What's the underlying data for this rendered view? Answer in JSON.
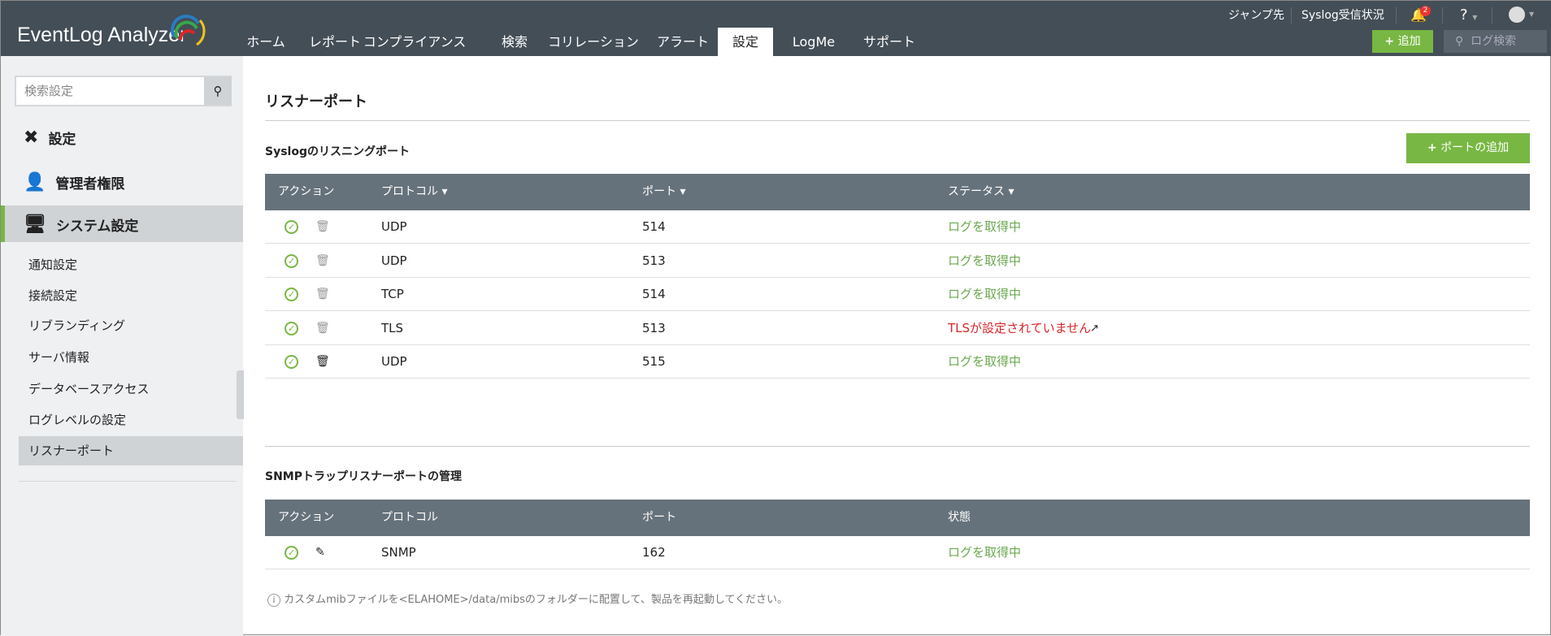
{
  "header": {
    "logo": "EventLog Analyzer",
    "tabs": [
      "ホーム",
      "レポート",
      "コンプライアンス",
      "検索",
      "コリレーション",
      "アラート",
      "設定",
      "LogMe",
      "サポート"
    ],
    "active_tab": "設定",
    "jump": "ジャンプ先",
    "syslog_status": "Syslog受信状況",
    "notification_count": "2",
    "help": "?",
    "add_label": "追加",
    "log_search_placeholder": "ログ検索"
  },
  "sidebar": {
    "search_placeholder": "検索設定",
    "menu": [
      "設定",
      "管理者権限",
      "システム設定"
    ],
    "sub_items": [
      "通知設定",
      "接続設定",
      "リブランディング",
      "サーバ情報",
      "データベースアクセス",
      "ログレベルの設定",
      "リスナーポート"
    ],
    "active_sub": "リスナーポート"
  },
  "main": {
    "title": "リスナーポート",
    "syslog": {
      "heading": "Syslogのリスニングポート",
      "add_button": "ポートの追加",
      "columns": [
        "アクション",
        "プロトコル",
        "ポート",
        "ステータス"
      ],
      "rows": [
        {
          "protocol": "UDP",
          "port": "514",
          "status": "ログを取得中"
        },
        {
          "protocol": "UDP",
          "port": "513",
          "status": "ログを取得中"
        },
        {
          "protocol": "TCP",
          "port": "514",
          "status": "ログを取得中"
        },
        {
          "protocol": "TLS",
          "port": "513",
          "status": "TLSが設定されていません"
        },
        {
          "protocol": "UDP",
          "port": "515",
          "status": "ログを取得中"
        }
      ]
    },
    "snmp": {
      "heading": "SNMPトラップリスナーポートの管理",
      "columns": [
        "アクション",
        "プロトコル",
        "ポート",
        "状態"
      ],
      "rows": [
        {
          "protocol": "SNMP",
          "port": "162",
          "status": "ログを取得中"
        }
      ]
    },
    "note": "カスタムmibファイルを<ELAHOME>/data/mibsのフォルダーに配置して、製品を再起動してください。"
  },
  "colors": {
    "header": "#434e57",
    "green": "#78b743",
    "table_head": "#66727b",
    "error": "#d9262b"
  }
}
